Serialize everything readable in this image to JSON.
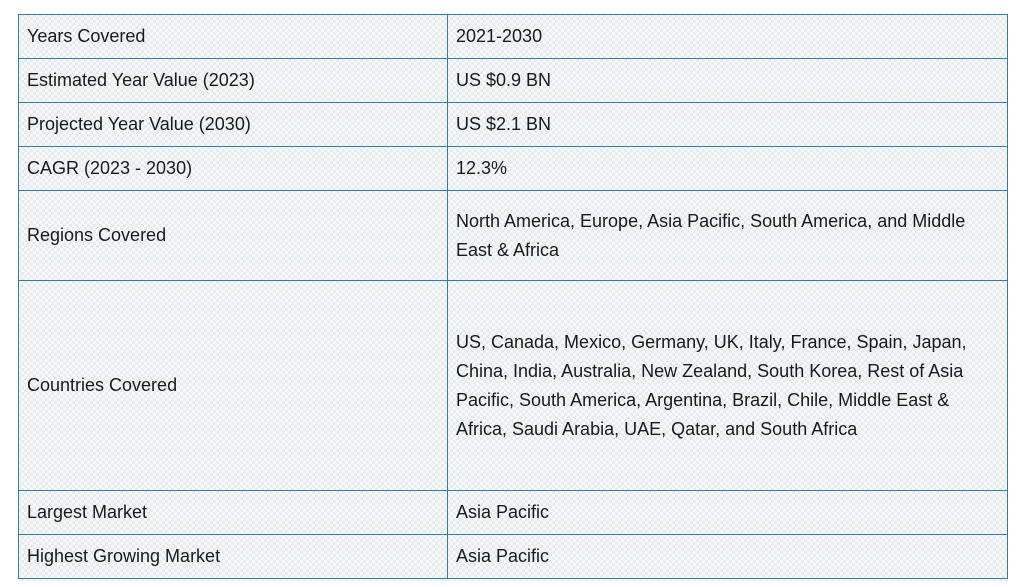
{
  "table": {
    "rows": [
      {
        "label": "Years Covered",
        "value": "2021-2030"
      },
      {
        "label": "Estimated Year Value (2023)",
        "value": "US $0.9 BN"
      },
      {
        "label": "Projected Year Value (2030)",
        "value": "US $2.1 BN"
      },
      {
        "label": "CAGR (2023 - 2030)",
        "value": "12.3%"
      },
      {
        "label": "Regions Covered",
        "value": "North America, Europe, Asia Pacific, South America, and Middle East & Africa"
      },
      {
        "label": "Countries Covered",
        "value": "US, Canada, Mexico, Germany, UK, Italy, France, Spain, Japan, China, India, Australia, New Zealand, South Korea, Rest of Asia Pacific, South America, Argentina, Brazil, Chile, Middle East & Africa, Saudi Arabia, UAE, Qatar, and South Africa"
      },
      {
        "label": "Largest Market",
        "value": "Asia Pacific"
      },
      {
        "label": "Highest Growing Market",
        "value": "Asia Pacific"
      }
    ]
  },
  "colors": {
    "border": "#2d7fa6",
    "text": "#1a1a1a"
  }
}
